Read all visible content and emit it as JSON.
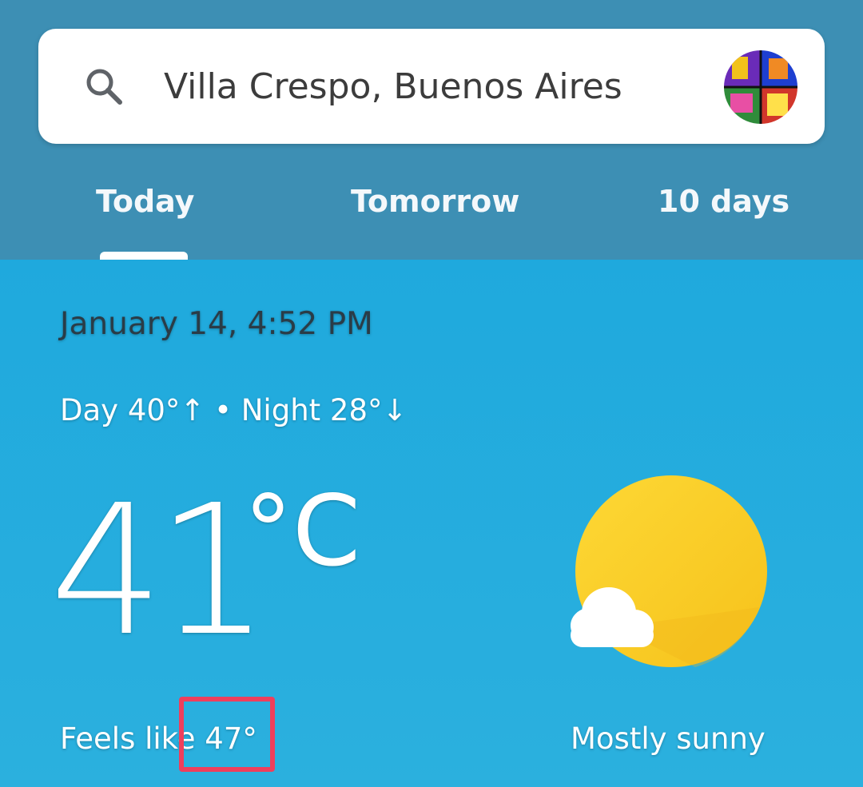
{
  "search": {
    "location": "Villa Crespo, Buenos Aires",
    "icon": "search-icon"
  },
  "tabs": [
    {
      "label": "Today",
      "selected": true
    },
    {
      "label": "Tomorrow",
      "selected": false
    },
    {
      "label": "10 days",
      "selected": false
    }
  ],
  "weather": {
    "date_time": "January 14, 4:52 PM",
    "day_night": "Day 40°↑ • Night 28°↓",
    "temperature": "41",
    "unit": "°C",
    "feels_like": "Feels like 47°",
    "condition": "Mostly sunny",
    "condition_icon": "mostly-sunny-icon"
  },
  "colors": {
    "header_bg": "#3d8fb4",
    "main_bg": "#28acdc",
    "sun": "#fdd835",
    "highlight": "#ef3f5c"
  }
}
